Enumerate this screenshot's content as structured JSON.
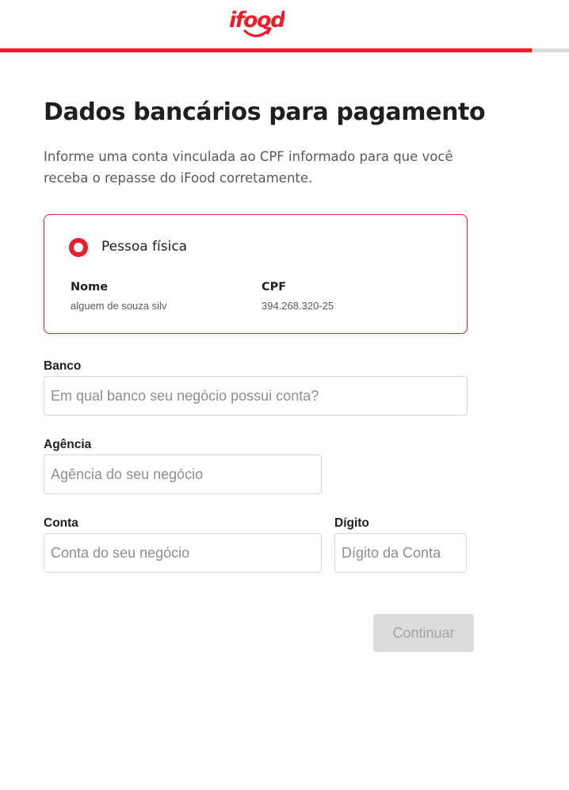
{
  "brand": {
    "logo_text": "ifood",
    "accent_color": "#ea1d2c"
  },
  "progress": {
    "fraction": 0.934
  },
  "page": {
    "title": "Dados bancários para pagamento",
    "subtitle": "Informe uma conta vinculada ao CPF informado para que você receba o repasse do iFood corretamente."
  },
  "account_type": {
    "selected": true,
    "label": "Pessoa física",
    "name_label": "Nome",
    "name_value": "alguem de souza silv",
    "cpf_label": "CPF",
    "cpf_value": "394.268.320-25"
  },
  "form": {
    "bank": {
      "label": "Banco",
      "value": "",
      "placeholder": "Em qual banco seu negócio possui conta?"
    },
    "agency": {
      "label": "Agência",
      "value": "",
      "placeholder": "Agência do seu negócio"
    },
    "account": {
      "label": "Conta",
      "value": "",
      "placeholder": "Conta do seu negócio"
    },
    "digit": {
      "label": "Dígito",
      "value": "",
      "placeholder": "Dígito da Conta"
    }
  },
  "actions": {
    "continue_label": "Continuar",
    "continue_enabled": false
  }
}
